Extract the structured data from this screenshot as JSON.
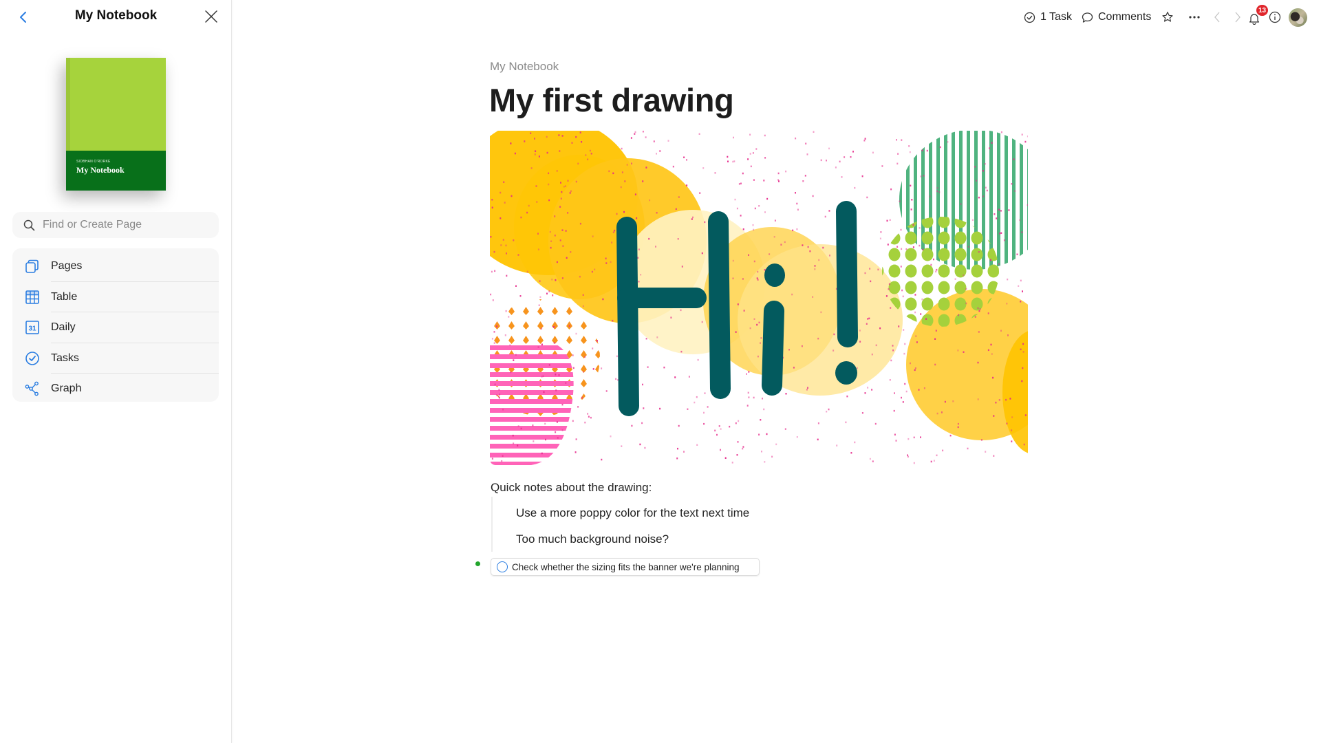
{
  "sidebar": {
    "title": "My Notebook",
    "back_icon": "chevron-left-icon",
    "close_icon": "close-icon",
    "book_cover": {
      "author": "SIOBHAN O'RORKE",
      "title": "My Notebook",
      "cover_color": "#a6d33c",
      "band_color": "#08701a"
    },
    "search": {
      "placeholder": "Find or Create Page",
      "value": "",
      "icon": "search-icon"
    },
    "nav": [
      {
        "label": "Pages",
        "icon": "pages-icon"
      },
      {
        "label": "Table",
        "icon": "table-icon"
      },
      {
        "label": "Daily",
        "icon": "calendar-icon",
        "icon_text": "31"
      },
      {
        "label": "Tasks",
        "icon": "check-circle-icon"
      },
      {
        "label": "Graph",
        "icon": "graph-icon"
      }
    ]
  },
  "topbar": {
    "tasks_label": "1 Task",
    "comments_label": "Comments",
    "notifications_count": "13",
    "icons": [
      "check-circle-icon",
      "comment-icon",
      "star-icon",
      "more-icon",
      "back-icon",
      "forward-icon",
      "bell-icon",
      "info-icon",
      "avatar"
    ]
  },
  "page": {
    "breadcrumb": "My Notebook",
    "title": "My first drawing",
    "drawing": {
      "text": "Hi!",
      "description": "Hand-drawn 'Hi!' in dark teal over yellow circles, pink striped shape, orange dot pattern, green dotted circle, green striped circle and pink speckles",
      "colors": {
        "letters": "#035a5e",
        "yellow": "#ffc300",
        "pink": "#ff5fb4",
        "orange": "#f7941d",
        "lime": "#a5d13c",
        "green": "#4fb37f"
      }
    },
    "paragraph": "Quick notes about the drawing:",
    "quote_items": [
      "Use a more poppy color for the text next time",
      "Too much background noise?"
    ],
    "task": {
      "text": "Check whether the sizing fits the banner we're planning",
      "done": false
    }
  },
  "colors": {
    "accent": "#2a7de1",
    "badge": "#e0262c",
    "task_dot": "#22a52c"
  }
}
